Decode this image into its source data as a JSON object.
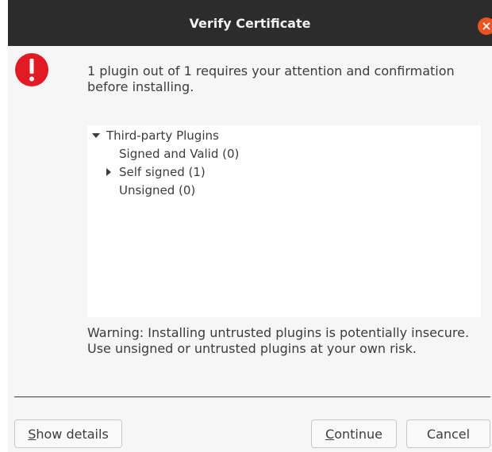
{
  "window": {
    "title": "Verify Certificate",
    "accent_color": "#e95420"
  },
  "message": "1 plugin out of 1 requires your attention and confirmation before installing.",
  "tree": {
    "root": {
      "label": "Third-party Plugins",
      "expanded": true
    },
    "children": [
      {
        "label": "Signed and Valid (0)",
        "expandable": false
      },
      {
        "label": "Self signed (1)",
        "expandable": true,
        "expanded": false
      },
      {
        "label": "Unsigned (0)",
        "expandable": false
      }
    ]
  },
  "warning": "Warning: Installing untrusted plugins is potentially insecure. Use unsigned or untrusted plugins at your own risk.",
  "buttons": {
    "show_details": {
      "mnemonic": "S",
      "rest": "how details"
    },
    "continue": {
      "mnemonic": "C",
      "rest": "ontinue"
    },
    "cancel": {
      "label": "Cancel"
    }
  },
  "icons": {
    "alert": "error-exclamation-icon",
    "close": "close-icon",
    "expanded": "triangle-down-icon",
    "collapsed": "triangle-right-icon"
  }
}
